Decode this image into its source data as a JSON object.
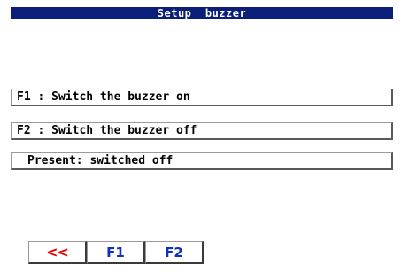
{
  "title": "Setup  buzzer",
  "options": [
    {
      "label": "F1 : Switch the buzzer on"
    },
    {
      "label": "F2 : Switch the buzzer off"
    }
  ],
  "status": "Present: switched off",
  "softkeys": {
    "back": "<<",
    "f1": "F1",
    "f2": "F2"
  },
  "colors": {
    "title_bg": "#0b1f7a",
    "back_key": "#e00000",
    "fkey": "#1030c0"
  },
  "icons": {
    "back": "double-chevron-left-icon"
  }
}
